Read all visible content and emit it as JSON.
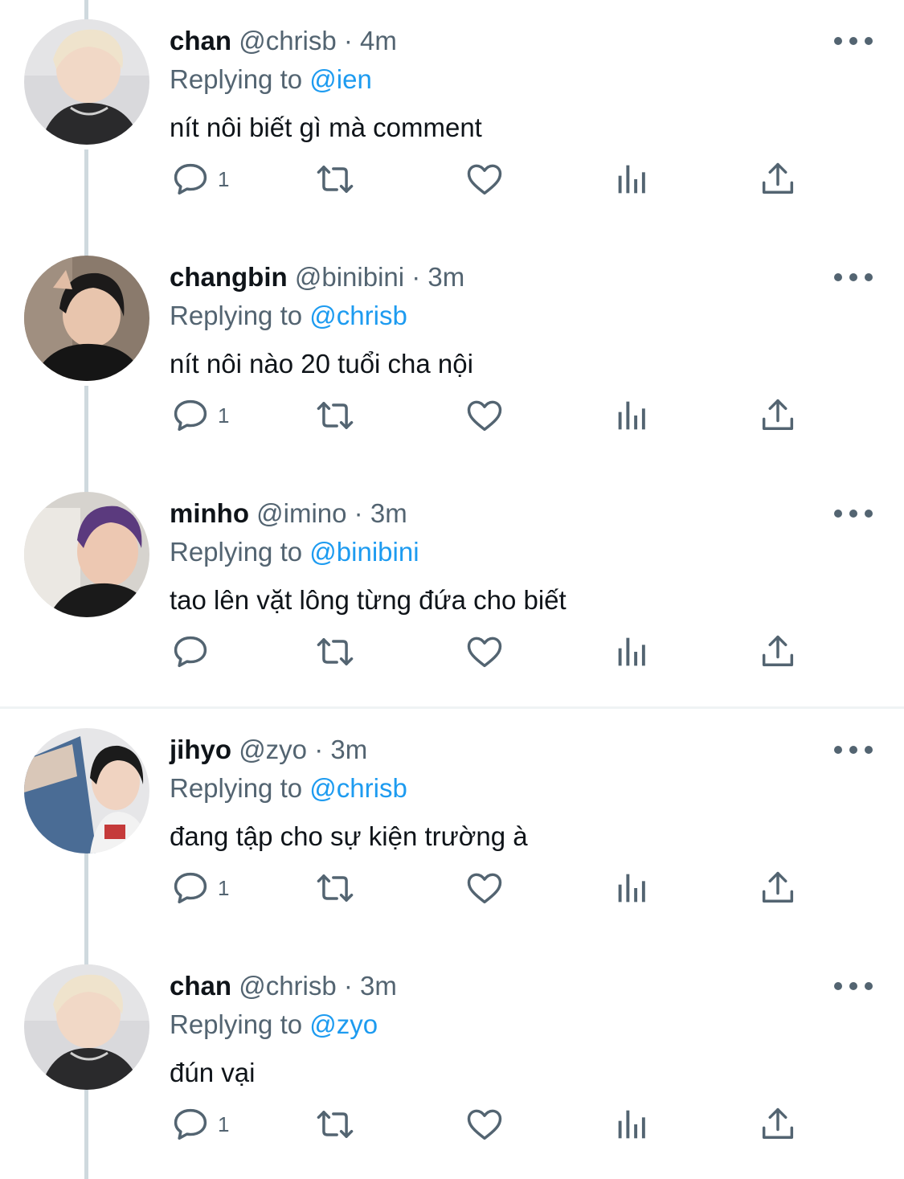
{
  "tweets": [
    {
      "name": "chan",
      "meta": "@chrisb · 4m",
      "replying_prefix": "Replying to",
      "replying_to": "@ien",
      "text": "nít nôi biết gì mà comment",
      "reply_count": "1"
    },
    {
      "name": "changbin",
      "meta": "@binibini · 3m",
      "replying_prefix": "Replying to",
      "replying_to": "@chrisb",
      "text": "nít nôi nào 20 tuổi cha nội",
      "reply_count": "1"
    },
    {
      "name": "minho",
      "meta": "@imino · 3m",
      "replying_prefix": "Replying to",
      "replying_to": "@binibini",
      "text": "tao lên vặt lông từng đứa cho biết",
      "reply_count": ""
    },
    {
      "name": "jihyo",
      "meta": "@zyo · 3m",
      "replying_prefix": "Replying to",
      "replying_to": "@chrisb",
      "text": "đang tập cho sự kiện trường à",
      "reply_count": "1"
    },
    {
      "name": "chan",
      "meta": "@chrisb · 3m",
      "replying_prefix": "Replying to",
      "replying_to": "@zyo",
      "text": "đún vại",
      "reply_count": "1"
    }
  ],
  "icons": {
    "reply": "speech-bubble-icon",
    "retweet": "retweet-icon",
    "like": "heart-icon",
    "views": "bar-chart-icon",
    "share": "share-upload-icon",
    "more": "more-dots-icon"
  },
  "colors": {
    "text": "#0f1419",
    "secondary": "#536471",
    "mention": "#1d9bf0",
    "thread_line": "#cfd9de",
    "divider": "#eff3f4"
  }
}
